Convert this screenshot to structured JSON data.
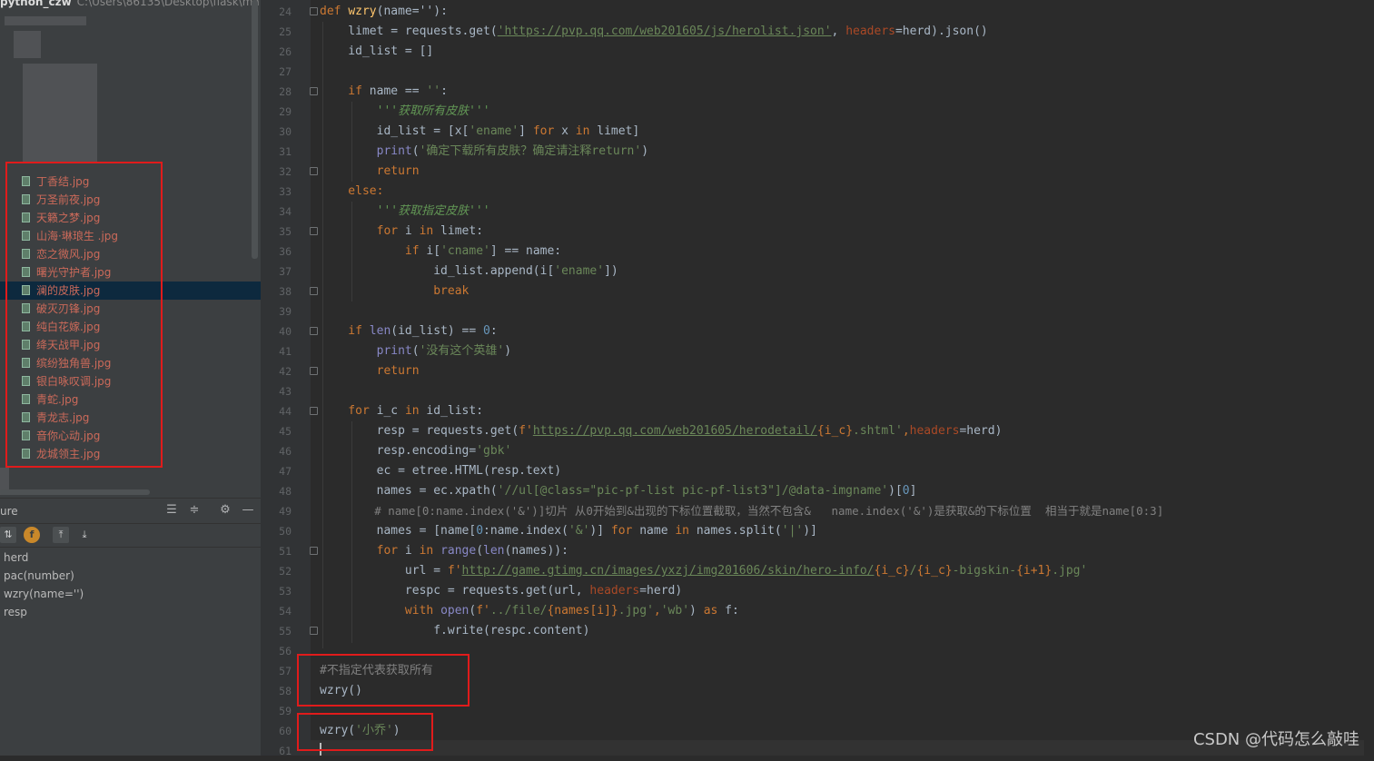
{
  "project": {
    "name": "python_czw",
    "path": "C:\\Users\\86135\\Desktop\\flask\\ma..."
  },
  "files": [
    "丁香结.jpg",
    "万圣前夜.jpg",
    "天籁之梦.jpg",
    "山海·琳琅生 .jpg",
    "恋之微风.jpg",
    "曙光守护者.jpg",
    "澜的皮肤.jpg",
    "破灭刃锋.jpg",
    "纯白花嫁.jpg",
    "绛天战甲.jpg",
    "缤纷独角兽.jpg",
    "银白咏叹调.jpg",
    "青蛇.jpg",
    "青龙志.jpg",
    "音你心动.jpg",
    "龙城领主.jpg"
  ],
  "selected_file": "澜的皮肤.jpg",
  "structure": {
    "title": "ure",
    "items": [
      "herd",
      "pac(number)",
      "wzry(name='')",
      "resp"
    ]
  },
  "line_numbers": [
    "24",
    "25",
    "26",
    "27",
    "28",
    "29",
    "30",
    "31",
    "32",
    "33",
    "34",
    "35",
    "36",
    "37",
    "38",
    "39",
    "40",
    "41",
    "42",
    "43",
    "44",
    "45",
    "46",
    "47",
    "48",
    "49",
    "50",
    "51",
    "52",
    "53",
    "54",
    "55",
    "56",
    "57",
    "58",
    "59",
    "60",
    "61"
  ],
  "code": {
    "l24": {
      "def": "def ",
      "name": "wzry",
      "rest": "(name=''):"
    },
    "l25": {
      "a": "    limet = requests.get(",
      "url": "'https://pvp.qq.com/web201605/js/herolist.json'",
      "b": ", ",
      "p": "headers",
      "c": "=herd).json()"
    },
    "l26": "    id_list = []",
    "l28": {
      "kw": "    if ",
      "a": "name == ",
      "s": "''",
      "b": ":"
    },
    "l29": "        '''获取所有皮肤'''",
    "l30": {
      "a": "        id_list = [x[",
      "s": "'ename'",
      "b": "] ",
      "kw1": "for",
      "c": " x ",
      "kw2": "in",
      "d": " limet]"
    },
    "l31": {
      "a": "        ",
      "bi": "print",
      "b": "(",
      "s": "'确定下载所有皮肤？确定请注释return'",
      "c": ")"
    },
    "l32": "        return",
    "l33": "    else:",
    "l34": "        '''获取指定皮肤'''",
    "l35": {
      "kw1": "        for",
      "a": " i ",
      "kw2": "in",
      "b": " limet:"
    },
    "l36": {
      "kw": "            if",
      "a": " i[",
      "s": "'cname'",
      "b": "] == name:"
    },
    "l37": {
      "a": "                id_list.append(i[",
      "s": "'ename'",
      "b": "])"
    },
    "l38": "                break",
    "l40": {
      "kw": "    if ",
      "bi": "len",
      "a": "(id_list) == ",
      "n": "0",
      "b": ":"
    },
    "l41": {
      "a": "        ",
      "bi": "print",
      "b": "(",
      "s": "'没有这个英雄'",
      "c": ")"
    },
    "l42": "        return",
    "l44": {
      "kw1": "    for",
      "a": " i_c ",
      "kw2": "in",
      "b": " id_list:"
    },
    "l45": {
      "a": "        resp = requests.get(",
      "f": "f'",
      "url": "https://pvp.qq.com/web201605/herodetail/",
      "br": "{i_c}",
      "s": ".shtml'",
      "c": ",",
      "p": "headers",
      "d": "=herd)"
    },
    "l46": {
      "a": "        resp.encoding=",
      "s": "'gbk'"
    },
    "l47": "        ec = etree.HTML(resp.text)",
    "l48": {
      "a": "        names = ec.xpath(",
      "s": "'//ul[@class=\"pic-pf-list pic-pf-list3\"]/@data-imgname'",
      "b": ")[",
      "n": "0",
      "c": "]"
    },
    "l49": "        # name[0:name.index('&')]切片 从0开始到&出现的下标位置截取，当然不包含&   name.index('&')是获取&的下标位置  相当于就是name[0:3]",
    "l50": {
      "a": "        names = [name[",
      "n": "0",
      "b": ":name.index(",
      "s": "'&'",
      "c": ")] ",
      "kw1": "for",
      "d": " name ",
      "kw2": "in",
      "e": " names.split(",
      "s2": "'|'",
      "f": ")]"
    },
    "l51": {
      "kw1": "        for",
      "a": " i ",
      "kw2": "in",
      "b": " ",
      "bi1": "range",
      "c": "(",
      "bi2": "len",
      "d": "(names)):"
    },
    "l52": {
      "a": "            url = ",
      "f": "f'",
      "url": "http://game.gtimg.cn/images/yxzj/img201606/skin/hero-info/",
      "br1": "{i_c}",
      "s1": "/",
      "br2": "{i_c}",
      "s2": "-bigskin-",
      "br3": "{i+1}",
      "s3": ".jpg'"
    },
    "l53": {
      "a": "            respc = requests.get(url, ",
      "p": "headers",
      "b": "=herd)"
    },
    "l54": {
      "kw1": "            with",
      "a": " ",
      "bi": "open",
      "b": "(",
      "f": "f'",
      "s1": "../file/",
      "br": "{names[i]}",
      "s2": ".jpg'",
      "c": ",",
      "s3": "'wb'",
      "d": ") ",
      "kw2": "as",
      "e": " f:"
    },
    "l55": "                f.write(respc.content)",
    "l57": "#不指定代表获取所有",
    "l58": "wzry()",
    "l60": {
      "a": "wzry(",
      "s": "'小乔'",
      "b": ")"
    }
  },
  "watermark": "CSDN @代码怎么敲哇",
  "colors": {
    "annotation_box": "#e01b1b",
    "selection": "#0d293e",
    "keyword": "#cc7832",
    "string": "#6a8759",
    "function": "#ffc66d"
  }
}
